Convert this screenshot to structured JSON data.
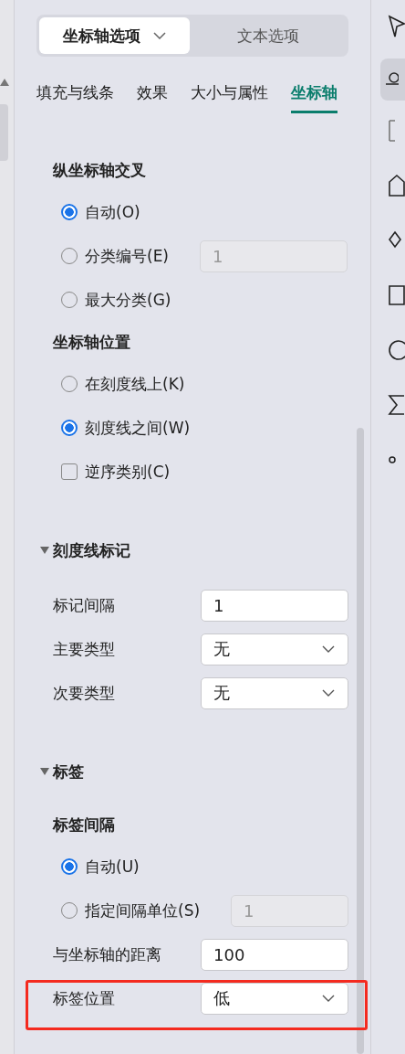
{
  "segments": [
    {
      "label": "坐标轴选项",
      "selected": true,
      "dropdown": true
    },
    {
      "label": "文本选项",
      "selected": false,
      "dropdown": false
    }
  ],
  "tabs": [
    {
      "label": "填充与线条",
      "selected": false
    },
    {
      "label": "效果",
      "selected": false
    },
    {
      "label": "大小与属性",
      "selected": false
    },
    {
      "label": "坐标轴",
      "selected": true
    }
  ],
  "rows": [
    {
      "kind": "subheading",
      "text": "纵坐标轴交叉"
    },
    {
      "kind": "radio",
      "label": "自动(O)",
      "selected": true
    },
    {
      "kind": "radio",
      "label": "分类编号(E)",
      "selected": false,
      "field": {
        "value": "1",
        "disabled": true
      }
    },
    {
      "kind": "radio",
      "label": "最大分类(G)",
      "selected": false
    },
    {
      "kind": "subheading",
      "text": "坐标轴位置"
    },
    {
      "kind": "radio",
      "label": "在刻度线上(K)",
      "selected": false
    },
    {
      "kind": "radio",
      "label": "刻度线之间(W)",
      "selected": true
    },
    {
      "kind": "checkbox",
      "label": "逆序类别(C)",
      "checked": false
    },
    {
      "kind": "section",
      "text": "刻度线标记",
      "expanded": true
    },
    {
      "kind": "input",
      "label": "标记间隔",
      "value": "1"
    },
    {
      "kind": "select",
      "label": "主要类型",
      "value": "无"
    },
    {
      "kind": "select",
      "label": "次要类型",
      "value": "无"
    },
    {
      "kind": "section",
      "text": "标签",
      "expanded": true
    },
    {
      "kind": "subheading",
      "text": "标签间隔"
    },
    {
      "kind": "radio",
      "label": "自动(U)",
      "selected": true
    },
    {
      "kind": "radio",
      "label": "指定间隔单位(S)",
      "selected": false,
      "field": {
        "value": "1",
        "disabled": true
      }
    },
    {
      "kind": "input",
      "label": "与坐标轴的距离",
      "value": "100"
    },
    {
      "kind": "select",
      "label": "标签位置",
      "value": "低",
      "highlighted": true
    }
  ]
}
